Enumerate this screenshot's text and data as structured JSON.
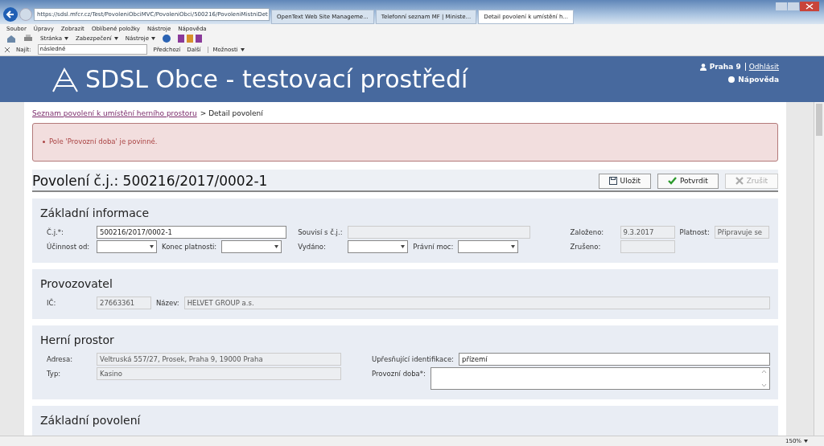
{
  "browser": {
    "url": "https://sdsl.mfcr.cz/Test/PovoleniObciMVC/PovoleniObci/500216/PovoleniMistniDet",
    "tabs": [
      {
        "label": "OpenText Web Site Manageme...",
        "selected": false
      },
      {
        "label": "Telefonní seznam MF | Ministe...",
        "selected": false
      },
      {
        "label": "Detail povolení k umístění h...",
        "selected": true
      }
    ],
    "menu": [
      "Soubor",
      "Úpravy",
      "Zobrazit",
      "Oblíbené položky",
      "Nástroje",
      "Nápověda"
    ],
    "toolbar": [
      "Stránka",
      "Zabezpečení",
      "Nástroje"
    ],
    "find": {
      "label": "Najít:",
      "value": "následné",
      "buttons": [
        "Předchozí",
        "Další"
      ],
      "options": "Možnosti"
    },
    "zoom": "150%"
  },
  "header": {
    "title": "SDSL Obce - testovací prostředí",
    "user": "Praha 9",
    "logout": "Odhlásit",
    "help": "Nápověda"
  },
  "breadcrumb": {
    "link": "Seznam povolení k umístění herního prostoru",
    "current": "> Detail povolení"
  },
  "errors": [
    "Pole 'Provozní doba' je povinné."
  ],
  "title": "Povolení č.j.: 500216/2017/0002-1",
  "buttons": [
    {
      "label": "Uložit",
      "kind": "save",
      "disabled": false
    },
    {
      "label": "Potvrdit",
      "kind": "confirm",
      "disabled": false
    },
    {
      "label": "Zrušit",
      "kind": "cancel",
      "disabled": true
    }
  ],
  "sections": [
    {
      "title": "Základní informace",
      "groups": [
        {
          "rows": [
            [
              {
                "label": "Č.j.*:",
                "kind": "text",
                "value": "500216/2017/0002-1",
                "readonly": false
              }
            ],
            [
              {
                "label": "Účinnost od:",
                "kind": "select",
                "readonly": false
              },
              {
                "label": "Konec platnosti:",
                "kind": "select",
                "readonly": false
              }
            ]
          ]
        },
        {
          "rows": [
            [
              {
                "label": "Souvisí s č.j.:",
                "kind": "text",
                "readonly": true
              }
            ],
            [
              {
                "label": "Vydáno:",
                "kind": "select",
                "readonly": false
              },
              {
                "label": "Právní moc:",
                "kind": "select",
                "readonly": false
              }
            ]
          ]
        },
        {
          "rows": [
            [
              {
                "label": "Založeno:",
                "kind": "short",
                "value": "9.3.2017",
                "readonly": true
              },
              {
                "label": "Platnost:",
                "kind": "short",
                "value": "Připravuje se",
                "readonly": true
              }
            ],
            [
              {
                "label": "Zrušeno:",
                "kind": "short",
                "readonly": true
              }
            ]
          ]
        }
      ]
    },
    {
      "title": "Provozovatel",
      "groups": [
        {
          "rows": [
            [
              {
                "label": "IČ:",
                "kind": "short",
                "value": "27663361",
                "readonly": true
              },
              {
                "label": "Název:",
                "kind": "text",
                "value": "HELVET GROUP a.s.",
                "readonly": true
              }
            ]
          ]
        }
      ]
    },
    {
      "title": "Herní prostor",
      "groups": [
        {
          "rows": [
            [
              {
                "label": "Adresa:",
                "kind": "text",
                "value": "Veltruská 557/27, Prosek, Praha 9, 19000 Praha",
                "readonly": true
              }
            ],
            [
              {
                "label": "Typ:",
                "kind": "text",
                "value": "Kasino",
                "readonly": true
              }
            ]
          ]
        },
        {
          "rows": [
            [
              {
                "label": "Upřesňující identifikace:",
                "kind": "text",
                "value": "přízemí",
                "readonly": false
              }
            ],
            [
              {
                "label": "Provozní doba*:",
                "kind": "textarea",
                "readonly": false
              }
            ]
          ]
        }
      ]
    },
    {
      "title": "Základní povolení"
    }
  ]
}
